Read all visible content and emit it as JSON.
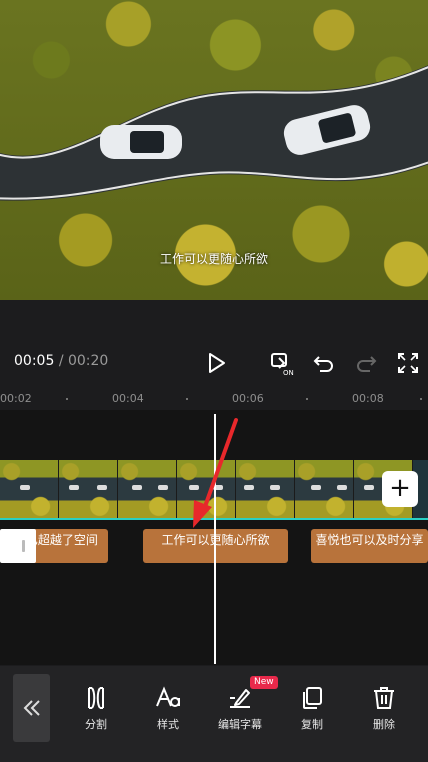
{
  "preview": {
    "subtitle": "工作可以更随心所欲"
  },
  "controls": {
    "current_time": "00:05",
    "separator": "/",
    "total_time": "00:20",
    "icons": [
      "play-icon",
      "keyframe-on-icon",
      "undo-icon",
      "redo-icon",
      "fullscreen-icon"
    ]
  },
  "ruler": {
    "labels": [
      "00:02",
      "00:04",
      "00:06",
      "00:08"
    ]
  },
  "timeline": {
    "captions": [
      {
        "text": "间   已超越了空间"
      },
      {
        "text": "工作可以更随心所欲"
      },
      {
        "text": "喜悦也可以及时分享"
      }
    ],
    "add_label": "+"
  },
  "toolbar": {
    "tools": [
      {
        "label": "分割",
        "icon": "split-icon"
      },
      {
        "label": "样式",
        "icon": "text-style-icon"
      },
      {
        "label": "编辑字幕",
        "icon": "edit-subtitle-icon"
      },
      {
        "label": "复制",
        "icon": "copy-icon"
      },
      {
        "label": "删除",
        "icon": "delete-icon"
      }
    ],
    "new_badge": "New"
  },
  "colors": {
    "caption_bg": "#b8733b",
    "accent_line": "#2ad0c4",
    "annotation_arrow": "#e8282b"
  }
}
